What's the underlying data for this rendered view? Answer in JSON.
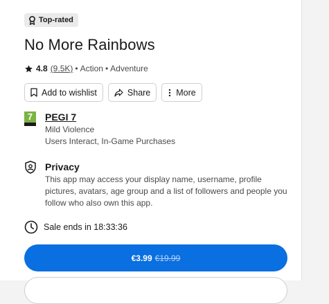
{
  "badge": {
    "label": "Top-rated",
    "icon": "ribbon-icon"
  },
  "game": {
    "title": "No More Rainbows",
    "rating": "4.8",
    "rating_count": "(9.5K)",
    "separator": "•",
    "genres": [
      "Action",
      "Adventure"
    ]
  },
  "actions": {
    "wishlist_label": "Add to wishlist",
    "share_label": "Share",
    "more_label": "More"
  },
  "pegi": {
    "title": "PEGI 7",
    "badge_number": "7",
    "badge_color": "#7cb342",
    "descriptors": [
      "Mild Violence",
      "Users Interact, In-Game Purchases"
    ]
  },
  "privacy": {
    "title": "Privacy",
    "text": "This app may access your display name, username, profile pictures, avatars, age group and a list of followers and people you follow who also own this app."
  },
  "sale": {
    "text": "Sale ends in 18:33:36"
  },
  "buy": {
    "price": "€3.99",
    "original_price": "€19.99",
    "color": "#0a6fe0"
  }
}
